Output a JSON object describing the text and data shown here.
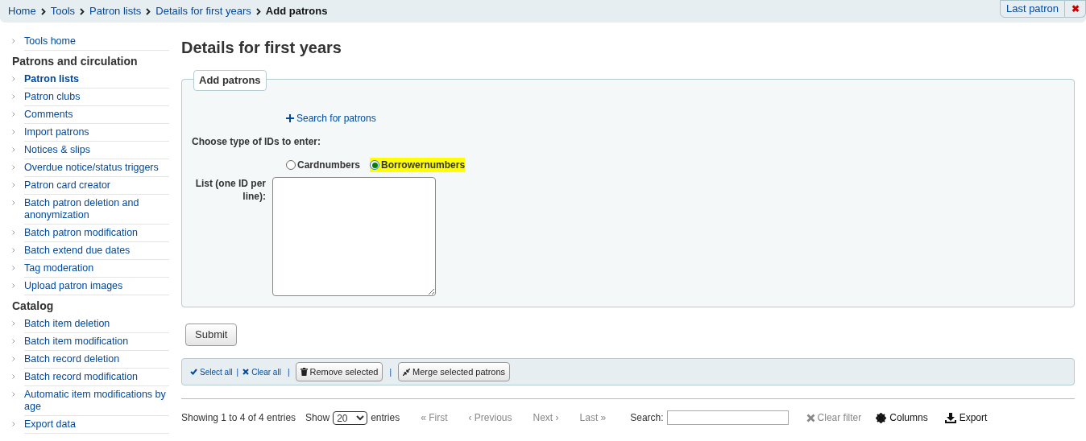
{
  "breadcrumb": [
    {
      "label": "Home",
      "current": false
    },
    {
      "label": "Tools",
      "current": false
    },
    {
      "label": "Patron lists",
      "current": false
    },
    {
      "label": "Details for first years",
      "current": false
    },
    {
      "label": "Add patrons",
      "current": true
    }
  ],
  "last_patron": {
    "label": "Last patron",
    "close": "✖"
  },
  "sidebar": [
    {
      "items": [
        {
          "label": "Tools home",
          "selected": false
        }
      ]
    },
    {
      "heading": "Patrons and circulation",
      "items": [
        {
          "label": "Patron lists",
          "selected": true
        },
        {
          "label": "Patron clubs",
          "selected": false
        },
        {
          "label": "Comments",
          "selected": false
        },
        {
          "label": "Import patrons",
          "selected": false
        },
        {
          "label": "Notices & slips",
          "selected": false
        },
        {
          "label": "Overdue notice/status triggers",
          "selected": false
        },
        {
          "label": "Patron card creator",
          "selected": false
        },
        {
          "label": "Batch patron deletion and anonymization",
          "selected": false
        },
        {
          "label": "Batch patron modification",
          "selected": false
        },
        {
          "label": "Batch extend due dates",
          "selected": false
        },
        {
          "label": "Tag moderation",
          "selected": false
        },
        {
          "label": "Upload patron images",
          "selected": false
        }
      ]
    },
    {
      "heading": "Catalog",
      "items": [
        {
          "label": "Batch item deletion",
          "selected": false
        },
        {
          "label": "Batch item modification",
          "selected": false
        },
        {
          "label": "Batch record deletion",
          "selected": false
        },
        {
          "label": "Batch record modification",
          "selected": false
        },
        {
          "label": "Automatic item modifications by age",
          "selected": false
        },
        {
          "label": "Export data",
          "selected": false
        }
      ]
    }
  ],
  "page_title": "Details for first years",
  "form": {
    "legend": "Add patrons",
    "search_link": "Search for patrons",
    "id_type_label": "Choose type of IDs to enter:",
    "id_types": [
      {
        "label": "Cardnumbers",
        "selected": false
      },
      {
        "label": "Borrowernumbers",
        "selected": true
      }
    ],
    "list_label": "List (one ID per line):"
  },
  "submit": "Submit",
  "toolbar": {
    "select_all": "Select all",
    "separators": [
      "|",
      "|",
      "|"
    ],
    "clear_all": "Clear all",
    "remove": "Remove selected",
    "merge": "Merge selected patrons"
  },
  "table_footer": {
    "info": "Showing 1 to 4 of 4 entries",
    "show": "Show",
    "page_size": "20",
    "entries": "entries",
    "pager": [
      {
        "label": "« First"
      },
      {
        "label": "‹ Previous"
      },
      {
        "label": "Next ›"
      },
      {
        "label": "Last »"
      }
    ],
    "search_label": "Search:",
    "clear_filter": "Clear filter",
    "columns": "Columns",
    "export": "Export"
  }
}
